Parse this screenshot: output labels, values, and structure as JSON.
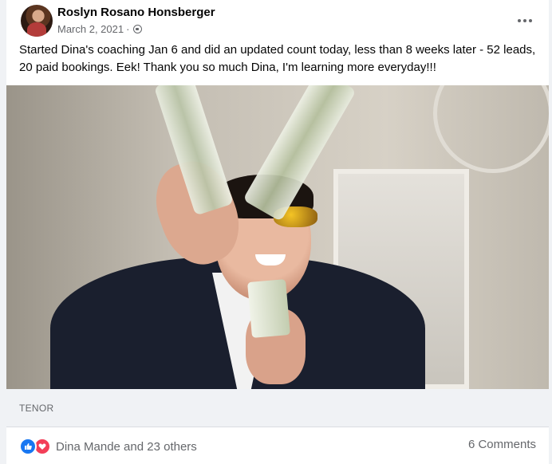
{
  "post": {
    "author": "Roslyn Rosano Honsberger",
    "date": "March 2, 2021",
    "separator": "·",
    "privacy_icon": "globe-icon",
    "body": "Started Dina's coaching Jan 6 and did an updated count today, less than 8 weeks later - 52 leads, 20 paid bookings. Eek!  Thank you so much Dina, I'm learning more everyday!!!"
  },
  "media": {
    "source_label": "TENOR"
  },
  "footer": {
    "reaction_icons": [
      "like-icon",
      "love-icon"
    ],
    "reactions_text": "Dina Mande and 23 others",
    "comments_text": "6 Comments"
  },
  "colors": {
    "like": "#1877f2",
    "love": "#f33e58",
    "secondary_text": "#65676b"
  }
}
